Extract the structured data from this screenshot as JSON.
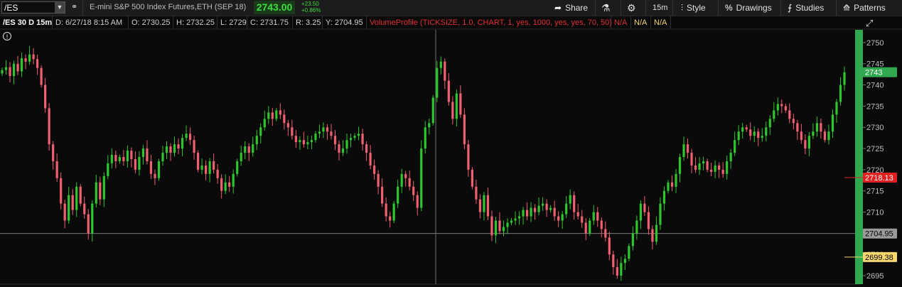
{
  "toolbar": {
    "symbol": "/ES",
    "description": "E-mini S&P 500 Index Futures,ETH (SEP 18)",
    "last_price": "2743.00",
    "change_abs": "+23.50",
    "change_pct": "+0.86%",
    "share_label": "Share",
    "timeframe_label": "15m",
    "style_label": "Style",
    "drawings_label": "Drawings",
    "studies_label": "Studies",
    "patterns_label": "Patterns"
  },
  "info": {
    "chart_id": "/ES 30 D 15m",
    "date": "D: 6/27/18 8:15 AM",
    "open": "O: 2730.25",
    "high": "H: 2732.25",
    "low": "L: 2729",
    "close": "C: 2731.75",
    "range": "R: 3.25",
    "y": "Y: 2704.95",
    "study": "VolumeProfile (TICKSIZE, 1.0, CHART, 1, yes, 1000, yes, yes, 70, 50)",
    "na1": "N/A",
    "na2": "N/A",
    "na3": "N/A"
  },
  "axis": {
    "ticks": [
      "2750",
      "2745",
      "2740",
      "2735",
      "2730",
      "2725",
      "2720",
      "2715",
      "2710",
      "2705",
      "2700",
      "2695"
    ],
    "current_price": "2743",
    "red_level": "2718.13",
    "crosshair_level": "2704.95",
    "yellow_level": "2699.38"
  },
  "colors": {
    "up": "#2fc52f",
    "down": "#f06070",
    "current": "#2fa84f",
    "red": "#e02020",
    "yellow": "#f5d76e"
  },
  "chart_data": {
    "type": "candlestick",
    "ylim": [
      2693,
      2753
    ],
    "closes": [
      2743.5,
      2744.2,
      2742.1,
      2745.0,
      2743.2,
      2746.3,
      2745.5,
      2747.2,
      2746.1,
      2744.0,
      2740.0,
      2734.5,
      2726.0,
      2722.0,
      2718.0,
      2712.0,
      2708.0,
      2714.0,
      2710.5,
      2716.0,
      2712.0,
      2709.5,
      2705.0,
      2712.0,
      2717.0,
      2713.0,
      2718.5,
      2721.5,
      2723.5,
      2722.0,
      2723.0,
      2722.0,
      2724.5,
      2722.5,
      2720.0,
      2723.0,
      2725.0,
      2722.0,
      2719.0,
      2718.0,
      2722.0,
      2724.0,
      2725.5,
      2724.0,
      2726.0,
      2725.0,
      2727.5,
      2728.5,
      2727.0,
      2724.0,
      2720.0,
      2721.0,
      2719.0,
      2722.0,
      2720.0,
      2718.0,
      2715.0,
      2717.0,
      2716.0,
      2719.0,
      2722.0,
      2724.0,
      2725.5,
      2724.0,
      2726.0,
      2728.0,
      2730.0,
      2732.0,
      2733.5,
      2732.0,
      2734.0,
      2733.0,
      2731.0,
      2730.0,
      2728.0,
      2726.5,
      2727.0,
      2726.0,
      2726.5,
      2727.0,
      2728.5,
      2729.0,
      2730.0,
      2729.0,
      2728.0,
      2726.0,
      2724.0,
      2725.0,
      2727.0,
      2727.5,
      2728.0,
      2728.5,
      2726.0,
      2724.0,
      2721.0,
      2719.0,
      2716.0,
      2712.0,
      2709.0,
      2708.0,
      2712.0,
      2716.0,
      2719.0,
      2718.0,
      2716.0,
      2714.0,
      2711.0,
      2725.0,
      2730.0,
      2731.0,
      2737.0,
      2744.0,
      2745.5,
      2741.0,
      2736.0,
      2732.0,
      2738.0,
      2733.0,
      2726.0,
      2720.0,
      2716.0,
      2713.0,
      2710.0,
      2714.0,
      2709.0,
      2704.5,
      2708.0,
      2705.5,
      2706.5,
      2707.5,
      2708.0,
      2708.5,
      2709.0,
      2710.5,
      2709.0,
      2711.0,
      2710.0,
      2711.5,
      2712.0,
      2710.5,
      2711.0,
      2709.0,
      2708.0,
      2709.5,
      2712.0,
      2714.0,
      2710.0,
      2709.0,
      2707.5,
      2705.0,
      2708.0,
      2710.0,
      2708.0,
      2706.0,
      2704.0,
      2700.0,
      2697.0,
      2695.0,
      2698.0,
      2699.0,
      2702.0,
      2705.0,
      2708.0,
      2712.0,
      2710.0,
      2706.0,
      2703.0,
      2707.0,
      2712.0,
      2715.0,
      2717.0,
      2716.0,
      2719.0,
      2723.0,
      2726.0,
      2724.0,
      2721.0,
      2720.0,
      2721.5,
      2722.0,
      2720.0,
      2719.5,
      2721.0,
      2720.0,
      2719.0,
      2722.0,
      2724.0,
      2727.0,
      2729.0,
      2730.0,
      2729.5,
      2728.0,
      2729.0,
      2727.5,
      2728.0,
      2730.0,
      2732.0,
      2734.0,
      2735.5,
      2735.0,
      2734.0,
      2732.0,
      2731.0,
      2729.0,
      2727.0,
      2725.0,
      2728.0,
      2729.0,
      2731.0,
      2729.0,
      2727.0,
      2729.0,
      2733.0,
      2736.0,
      2740.0,
      2743.0
    ]
  }
}
